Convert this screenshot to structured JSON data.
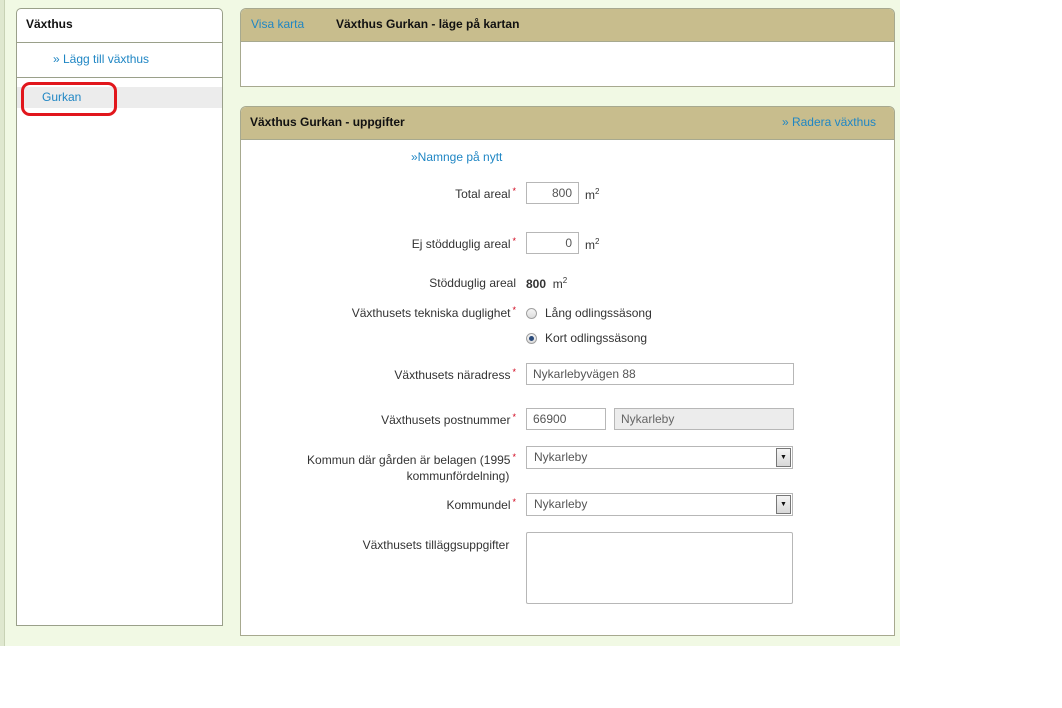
{
  "sidebar": {
    "title": "Växthus",
    "add_link": "» Lägg till växthus",
    "items": [
      {
        "label": "Gurkan"
      }
    ]
  },
  "map_panel": {
    "show_map_link": "Visa karta",
    "title": "Växthus Gurkan - läge på kartan"
  },
  "details_panel": {
    "title": "Växthus Gurkan - uppgifter",
    "delete_link": "» Radera växthus",
    "rename_link": "»Namnge på nytt",
    "required_marker": "*",
    "fields": {
      "total_area": {
        "label": "Total areal",
        "value": "800",
        "unit": "m",
        "unit_exp": "2"
      },
      "unsupported_area": {
        "label": "Ej stödduglig areal",
        "value": "0",
        "unit": "m",
        "unit_exp": "2"
      },
      "supported_area": {
        "label": "Stödduglig areal",
        "value": "800",
        "unit": "m",
        "unit_exp": "2"
      },
      "technical_fitness": {
        "label": "Växthusets tekniska duglighet",
        "options": [
          "Lång odlingssäsong",
          "Kort odlingssäsong"
        ],
        "selected": "Kort odlingssäsong"
      },
      "address": {
        "label": "Växthusets näradress",
        "value": "Nykarlebyvägen 88"
      },
      "postcode": {
        "label": "Växthusets postnummer",
        "value": "66900",
        "city": "Nykarleby"
      },
      "municipality": {
        "label_line1": "Kommun där gården är belagen (1995",
        "label_line2": "kommunfördelning)",
        "selected": "Nykarleby"
      },
      "municipality_part": {
        "label": "Kommundel",
        "selected": "Nykarleby"
      },
      "extra_info": {
        "label": "Växthusets tilläggsuppgifter",
        "value": ""
      }
    }
  },
  "colors": {
    "link": "#1f86c4",
    "panel_header": "#c8bd8d",
    "page_background": "#f1f9e4",
    "highlight": "#e1161c"
  }
}
